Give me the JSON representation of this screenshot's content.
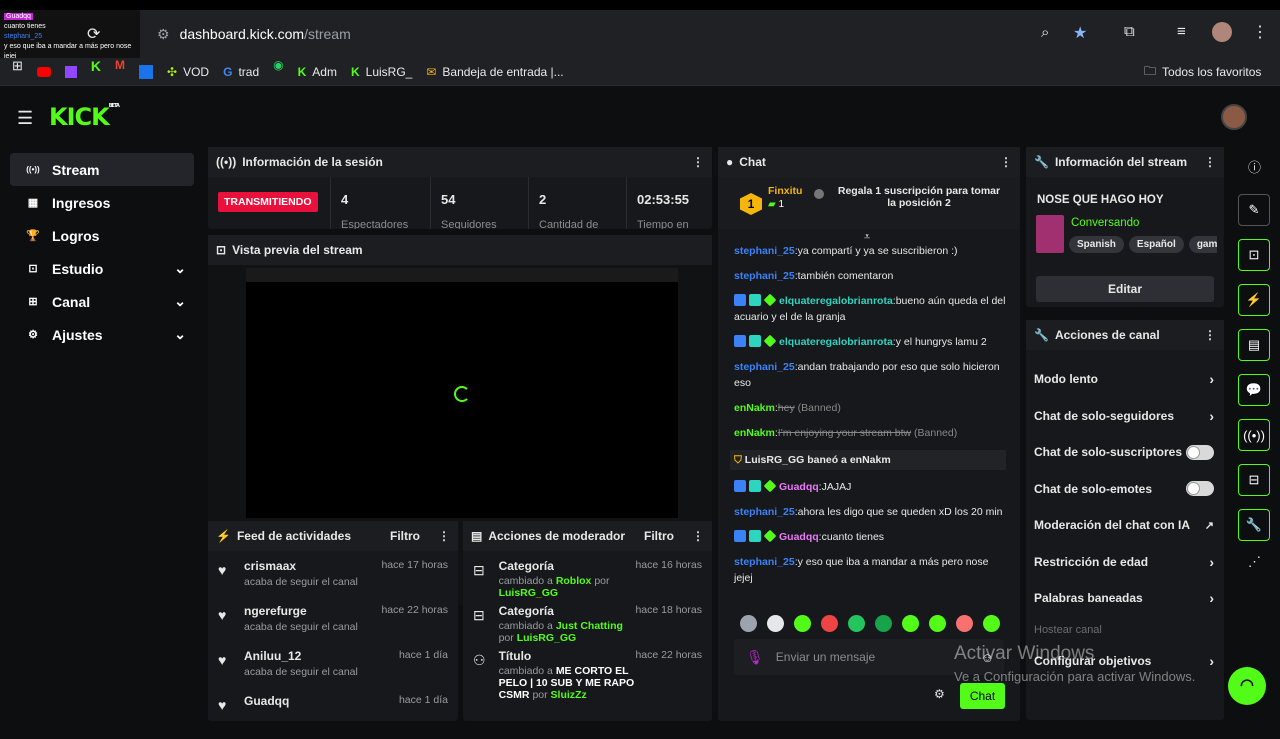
{
  "browser": {
    "url_domain": "dashboard.kick.com",
    "url_path": "/stream",
    "bookmarks": [
      "VOD",
      "trad",
      "Adm",
      "LuisRG_",
      "Bandeja de entrada |..."
    ],
    "all_bookmarks": "Todos los favoritos"
  },
  "overlay": {
    "user1": "Guadqq",
    "msg1": "cuanto tienes",
    "user2": "stephani_25",
    "msg2": "y eso que iba a mandar a más pero nose jejej"
  },
  "sidebar": {
    "items": [
      {
        "label": "Stream",
        "icon": "broadcast-icon",
        "active": true,
        "chevron": false
      },
      {
        "label": "Ingresos",
        "icon": "revenue-icon",
        "active": false,
        "chevron": false
      },
      {
        "label": "Logros",
        "icon": "trophy-icon",
        "active": false,
        "chevron": false
      },
      {
        "label": "Estudio",
        "icon": "studio-icon",
        "active": false,
        "chevron": true
      },
      {
        "label": "Canal",
        "icon": "channel-icon",
        "active": false,
        "chevron": true
      },
      {
        "label": "Ajustes",
        "icon": "gear-icon",
        "active": false,
        "chevron": true
      }
    ]
  },
  "session": {
    "title": "Información de la sesión",
    "status": "TRANSMITIENDO",
    "stats": [
      {
        "value": "4",
        "label": "Espectadores"
      },
      {
        "value": "54",
        "label": "Seguidores"
      },
      {
        "value": "2",
        "label": "Cantidad de"
      },
      {
        "value": "02:53:55",
        "label": "Tiempo en"
      }
    ]
  },
  "preview": {
    "title": "Vista previa del stream"
  },
  "activity": {
    "title": "Feed de actividades",
    "filter": "Filtro",
    "items": [
      {
        "name": "crismaax",
        "sub": "acaba de seguir el canal",
        "time": "hace 17 horas"
      },
      {
        "name": "ngerefurge",
        "sub": "acaba de seguir el canal",
        "time": "hace 22 horas"
      },
      {
        "name": "Aniluu_12",
        "sub": "acaba de seguir el canal",
        "time": "hace 1 día"
      },
      {
        "name": "Guadqq",
        "sub": "",
        "time": "hace 1 día"
      }
    ]
  },
  "modactions": {
    "title": "Acciones de moderador",
    "filter": "Filtro",
    "items": [
      {
        "name": "Categoría",
        "pre": "cambiado a",
        "value": "Roblox",
        "by": "por",
        "user": "LuisRG_GG",
        "time": "hace 16 horas"
      },
      {
        "name": "Categoría",
        "pre": "cambiado a",
        "value": "Just Chatting",
        "by": "por",
        "user": "LuisRG_GG",
        "time": "hace 18 horas"
      },
      {
        "name": "Título",
        "pre": "cambiado a",
        "value": "ME CORTO EL PELO | 10 SUB Y ME RAPO CSMR",
        "by": "por",
        "user": "SluizZz",
        "time": "hace 22 horas"
      }
    ]
  },
  "chat": {
    "title": "Chat",
    "top_user": "Finxitu",
    "top_count": "1",
    "top_rank": "1",
    "gift_text": "Regala 1 suscripción para tomar la posición 2",
    "messages": [
      {
        "user": "stephani_25",
        "cls": "u-blue",
        "badges": 0,
        "text": ":ya compartí y ya se suscribieron :)",
        "banned": false
      },
      {
        "user": "stephani_25",
        "cls": "u-blue",
        "badges": 0,
        "text": ":también comentaron",
        "banned": false
      },
      {
        "user": "elquateregalobrianrota",
        "cls": "u-teal",
        "badges": 3,
        "text": ":bueno aún queda el del acuario y el de la granja",
        "banned": false
      },
      {
        "user": "elquateregalobrianrota",
        "cls": "u-teal",
        "badges": 3,
        "text": ":y el hungrys lamu 2",
        "banned": false
      },
      {
        "user": "stephani_25",
        "cls": "u-blue",
        "badges": 0,
        "text": ":andan trabajando por eso que solo hicieron eso",
        "banned": false
      },
      {
        "user": "enNakm",
        "cls": "u-green",
        "badges": 0,
        "text": "hey",
        "banned": true,
        "tag": "(Banned)"
      },
      {
        "user": "enNakm",
        "cls": "u-green",
        "badges": 0,
        "text": "I'm enjoying your stream btw",
        "banned": true,
        "tag": "(Banned)"
      }
    ],
    "ban_notice": "LuisRG_GG baneó a enNakm",
    "messages2": [
      {
        "user": "Guadqq",
        "cls": "u-pink",
        "badges": 3,
        "text": ":JAJAJ"
      },
      {
        "user": "stephani_25",
        "cls": "u-blue",
        "badges": 0,
        "text": ":ahora les digo que se queden xD los 20 min"
      },
      {
        "user": "Guadqq",
        "cls": "u-pink",
        "badges": 3,
        "text": ":cuanto tienes"
      },
      {
        "user": "stephani_25",
        "cls": "u-blue",
        "badges": 0,
        "text": ":y eso que iba a mandar a más pero nose jejej"
      }
    ],
    "input_placeholder": "Enviar un mensaje",
    "send": "Chat"
  },
  "streaminfo": {
    "title": "Información del stream",
    "stream_title": "NOSE QUE HAGO HOY",
    "category": "Conversando",
    "tags": [
      "Spanish",
      "Español",
      "gam"
    ],
    "edit": "Editar"
  },
  "channel_actions": {
    "title": "Acciones de canal",
    "items": [
      {
        "label": "Modo lento",
        "ctrl": "chevron"
      },
      {
        "label": "Chat de solo-seguidores",
        "ctrl": "chevron"
      },
      {
        "label": "Chat de solo-suscriptores",
        "ctrl": "toggle"
      },
      {
        "label": "Chat de solo-emotes",
        "ctrl": "toggle"
      },
      {
        "label": "Moderación del chat con IA",
        "ctrl": "external"
      },
      {
        "label": "Restricción de edad",
        "ctrl": "chevron"
      },
      {
        "label": "Palabras baneadas",
        "ctrl": "chevron"
      }
    ],
    "host": "Hostear canal",
    "goals": "Configurar objetivos"
  },
  "watermark": {
    "line1": "Activar Windows",
    "line2": "Ve a Configuración para activar Windows."
  },
  "colors": {
    "accent": "#53fc18",
    "live": "#e9113c"
  }
}
